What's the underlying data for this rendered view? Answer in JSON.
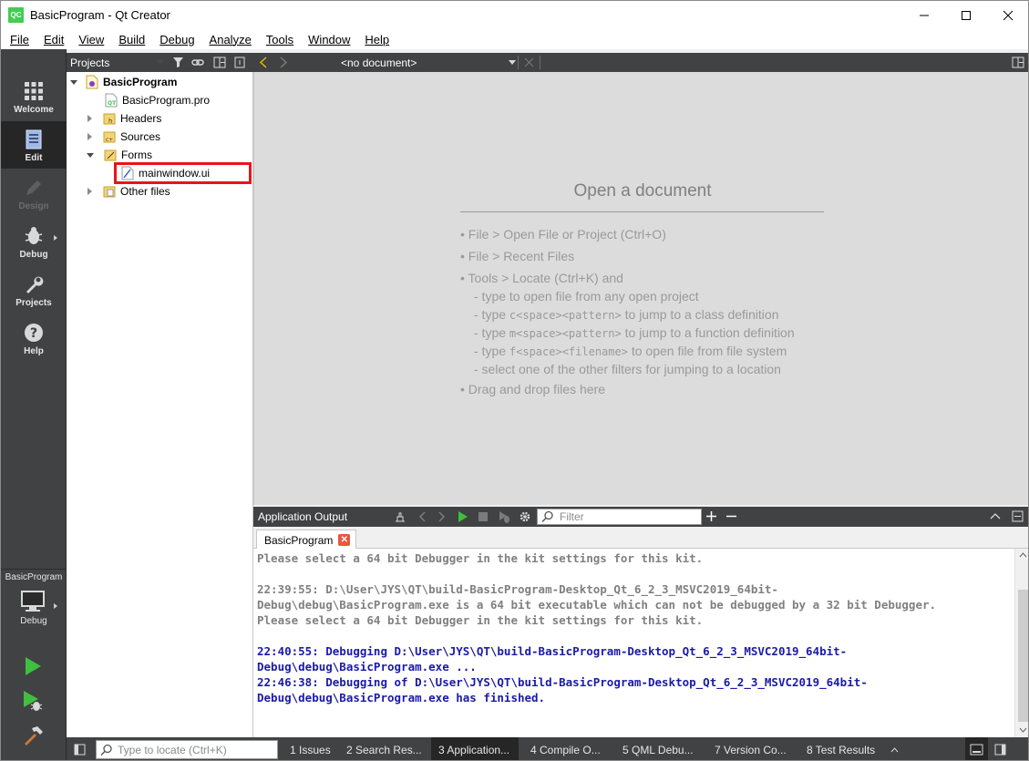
{
  "window": {
    "title": "BasicProgram - Qt Creator",
    "logo_text": "QC"
  },
  "menu": [
    "File",
    "Edit",
    "View",
    "Build",
    "Debug",
    "Analyze",
    "Tools",
    "Window",
    "Help"
  ],
  "modes": [
    {
      "label": "Welcome",
      "icon": "grid-icon",
      "state": "normal"
    },
    {
      "label": "Edit",
      "icon": "document-icon",
      "state": "active"
    },
    {
      "label": "Design",
      "icon": "pencil-icon",
      "state": "disabled"
    },
    {
      "label": "Debug",
      "icon": "bug-icon",
      "state": "normal"
    },
    {
      "label": "Projects",
      "icon": "wrench-icon",
      "state": "normal"
    },
    {
      "label": "Help",
      "icon": "question-icon",
      "state": "normal"
    }
  ],
  "kit": {
    "project": "BasicProgram",
    "build": "Debug"
  },
  "projects_pane": {
    "title": "Projects",
    "tree": [
      {
        "label": "BasicProgram",
        "expanded": true
      },
      {
        "label": "BasicProgram.pro"
      },
      {
        "label": "Headers",
        "expanded": false
      },
      {
        "label": "Sources",
        "expanded": false
      },
      {
        "label": "Forms",
        "expanded": true
      },
      {
        "label": "mainwindow.ui",
        "highlighted": true,
        "highlight_color": "#e8141b"
      },
      {
        "label": "Other files",
        "expanded": false
      }
    ]
  },
  "editor": {
    "document_selector": "<no document>",
    "heading": "Open a document",
    "hints": {
      "h1": "• File > Open File or Project (Ctrl+O)",
      "h2": "• File > Recent Files",
      "h3": "• Tools > Locate (Ctrl+K) and",
      "h4": "- type to open file from any open project",
      "h5a": "- type ",
      "h5b": "c<space><pattern>",
      "h5c": " to jump to a class definition",
      "h6a": "- type ",
      "h6b": "m<space><pattern>",
      "h6c": " to jump to a function definition",
      "h7a": "- type ",
      "h7b": "f<space><filename>",
      "h7c": " to open file from file system",
      "h8": "- select one of the other filters for jumping to a location",
      "h9": "• Drag and drop files here"
    }
  },
  "output": {
    "title": "Application Output",
    "filter_placeholder": "Filter",
    "tab_label": "BasicProgram",
    "lines": [
      "Please select a 64 bit Debugger in the kit settings for this kit.",
      "",
      "22:39:55: D:\\User\\JYS\\QT\\build-BasicProgram-Desktop_Qt_6_2_3_MSVC2019_64bit-",
      "Debug\\debug\\BasicProgram.exe is a 64 bit executable which can not be debugged by a 32 bit Debugger.",
      "Please select a 64 bit Debugger in the kit settings for this kit.",
      "",
      "22:40:55: Debugging D:\\User\\JYS\\QT\\build-BasicProgram-Desktop_Qt_6_2_3_MSVC2019_64bit-",
      "Debug\\debug\\BasicProgram.exe ...",
      "22:46:38: Debugging of D:\\User\\JYS\\QT\\build-BasicProgram-Desktop_Qt_6_2_3_MSVC2019_64bit-",
      "Debug\\debug\\BasicProgram.exe has finished."
    ]
  },
  "statusbar": {
    "locator_placeholder": "Type to locate (Ctrl+K)",
    "tabs": [
      "1  Issues",
      "2  Search Res...",
      "3  Application...",
      "4  Compile O...",
      "5  QML Debu...",
      "7  Version Co...",
      "8  Test Results"
    ]
  },
  "colors": {
    "accent_run": "#3fbf3f",
    "highlight_box": "#e8141b",
    "debug_text": "#1a1aa8"
  }
}
